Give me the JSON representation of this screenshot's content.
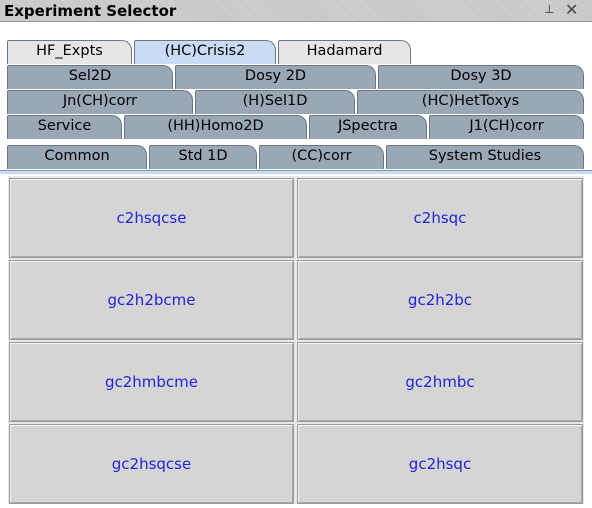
{
  "window": {
    "title": "Experiment Selector",
    "pin_glyph": "⊥",
    "close_glyph": "✕"
  },
  "tabs": {
    "row1": [
      "HF_Expts",
      "(HC)Crisis2",
      "Hadamard"
    ],
    "row2": [
      "Sel2D",
      "Dosy 2D",
      "Dosy 3D"
    ],
    "row3": [
      "Jn(CH)corr",
      "(H)Sel1D",
      "(HC)HetToxys"
    ],
    "row4": [
      "Service",
      "(HH)Homo2D",
      "JSpectra",
      "J1(CH)corr"
    ],
    "row5": [
      "Common",
      "Std 1D",
      "(CC)corr",
      "System Studies"
    ],
    "selected": "(HC)Crisis2"
  },
  "experiments": [
    "c2hsqcse",
    "c2hsqc",
    "gc2h2bcme",
    "gc2h2bc",
    "gc2hmbcme",
    "gc2hmbc",
    "gc2hsqcse",
    "gc2hsqc"
  ],
  "colors": {
    "selected_tab": "#c9dcf3",
    "inactive_tab": "#9aa8b6",
    "button_text": "#2323d8",
    "button_bg": "#d5d5d5"
  }
}
